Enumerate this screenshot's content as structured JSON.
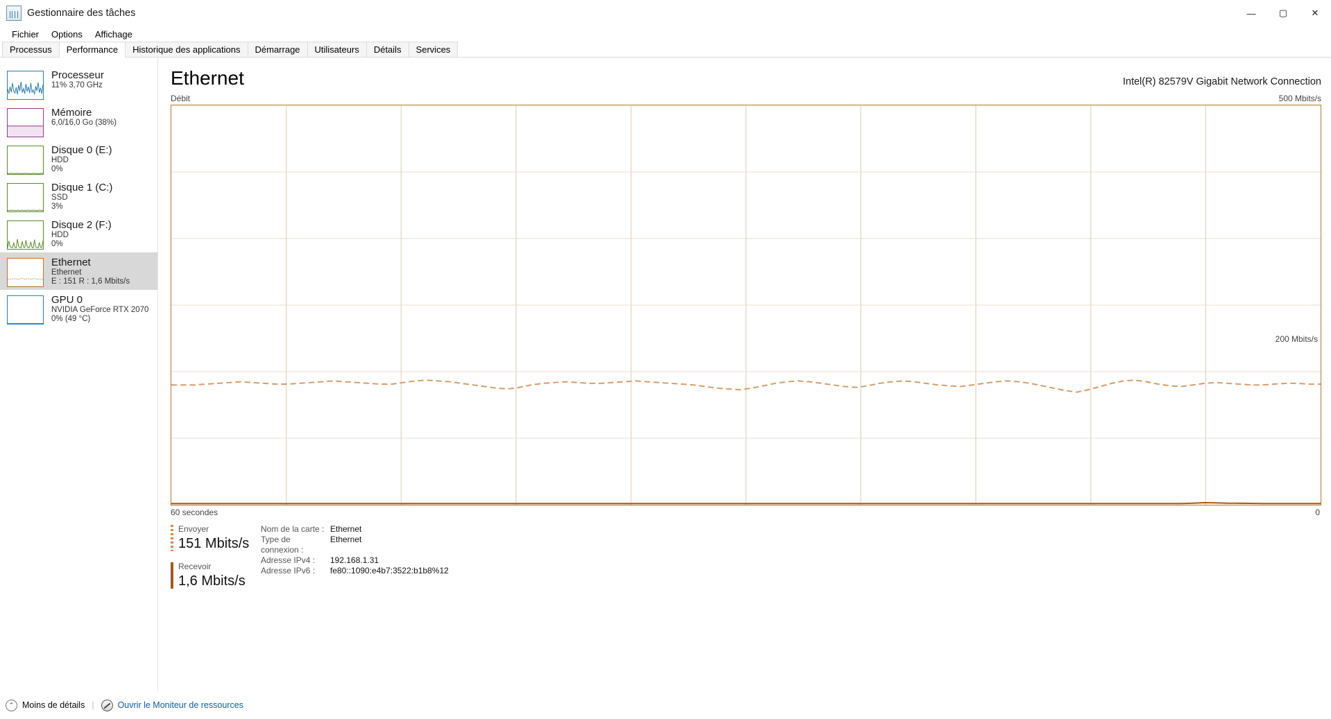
{
  "window": {
    "title": "Gestionnaire des tâches",
    "icon": "task-manager-icon",
    "minimize": "—",
    "maximize": "▢",
    "close": "✕"
  },
  "menu": [
    {
      "label": "Fichier"
    },
    {
      "label": "Options"
    },
    {
      "label": "Affichage"
    }
  ],
  "tabs": [
    {
      "label": "Processus",
      "active": false
    },
    {
      "label": "Performance",
      "active": true
    },
    {
      "label": "Historique des applications",
      "active": false
    },
    {
      "label": "Démarrage",
      "active": false
    },
    {
      "label": "Utilisateurs",
      "active": false
    },
    {
      "label": "Détails",
      "active": false
    },
    {
      "label": "Services",
      "active": false
    }
  ],
  "sidebar": {
    "items": [
      {
        "name": "Processeur",
        "line2": "11% 3,70 GHz",
        "line3": "",
        "color": "#2b7cac",
        "selected": false
      },
      {
        "name": "Mémoire",
        "line2": "6,0/16,0 Go (38%)",
        "line3": "",
        "color": "#8c3c8c",
        "selected": false
      },
      {
        "name": "Disque 0 (E:)",
        "line2": "HDD",
        "line3": "0%",
        "color": "#5a8a2e",
        "selected": false
      },
      {
        "name": "Disque 1 (C:)",
        "line2": "SSD",
        "line3": "3%",
        "color": "#5a8a2e",
        "selected": false
      },
      {
        "name": "Disque 2 (F:)",
        "line2": "HDD",
        "line3": "0%",
        "color": "#5a8a2e",
        "selected": false
      },
      {
        "name": "Ethernet",
        "line2": "Ethernet",
        "line3": "E : 151 R : 1,6 Mbits/s",
        "color": "#b4762b",
        "selected": true
      },
      {
        "name": "GPU 0",
        "line2": "NVIDIA GeForce RTX 2070",
        "line3": "0%  (49 °C)",
        "color": "#2b7cac",
        "selected": false
      }
    ]
  },
  "main": {
    "title": "Ethernet",
    "adapter": "Intel(R) 82579V Gigabit Network Connection",
    "graph_caption": "Débit",
    "axis_max": "500 Mbits/s",
    "axis_mid": "200 Mbits/s",
    "time_span": "60 secondes",
    "time_zero": "0"
  },
  "stats": {
    "send": {
      "label": "Envoyer",
      "value": "151 Mbits/s"
    },
    "receive": {
      "label": "Recevoir",
      "value": "1,6 Mbits/s"
    }
  },
  "details": [
    {
      "key": "Nom de la carte :",
      "value": "Ethernet"
    },
    {
      "key": "Type de connexion :",
      "value": "Ethernet"
    },
    {
      "key": "Adresse IPv4 :",
      "value": "192.168.1.31"
    },
    {
      "key": "Adresse IPv6 :",
      "value": "fe80::1090:e4b7:3522:b1b8%12"
    }
  ],
  "footer": {
    "less_details": "Moins de détails",
    "resource_monitor": "Ouvrir le Moniteur de ressources",
    "chevron": "⌃"
  },
  "colors": {
    "accent": "#b4762b",
    "send_line": "#d99c6b",
    "receive_line": "#a8571c",
    "grid": "#e8ddd0",
    "selected_bg": "#d8d8d8"
  },
  "chart_data": {
    "type": "line",
    "title": "Débit",
    "xlabel": "60 secondes",
    "ylabel": "Mbits/s",
    "ylim": [
      0,
      500
    ],
    "yticks": [
      200,
      500
    ],
    "grid": true,
    "legend": [
      "Envoyer",
      "Recevoir"
    ],
    "series": [
      {
        "name": "Envoyer",
        "style": "dashed",
        "color": "#d99c6b",
        "values": [
          150,
          150,
          150,
          151,
          152,
          153,
          154,
          153,
          152,
          151,
          151,
          152,
          153,
          154,
          155,
          154,
          153,
          152,
          151,
          151,
          153,
          155,
          156,
          155,
          154,
          152,
          150,
          148,
          146,
          145,
          147,
          150,
          152,
          153,
          154,
          153,
          152,
          152,
          153,
          154,
          155,
          154,
          153,
          152,
          151,
          150,
          148,
          146,
          145,
          144,
          146,
          149,
          152,
          154,
          155,
          154,
          152,
          150,
          148,
          147,
          149,
          152,
          154,
          155,
          154,
          152,
          150,
          149,
          148,
          150,
          152,
          154,
          155,
          154,
          152,
          149,
          146,
          143,
          141,
          144,
          148,
          152,
          155,
          156,
          154,
          151,
          149,
          148,
          150,
          152,
          153,
          152,
          151,
          150,
          150,
          151,
          152,
          152,
          151,
          151
        ]
      },
      {
        "name": "Recevoir",
        "style": "solid",
        "color": "#a8571c",
        "values": [
          1.6,
          1.6,
          1.6,
          1.6,
          1.6,
          1.6,
          1.6,
          1.6,
          1.6,
          1.6,
          1.6,
          1.6,
          1.6,
          1.6,
          1.6,
          1.6,
          1.6,
          1.6,
          1.6,
          1.6,
          1.6,
          1.6,
          1.6,
          1.6,
          1.6,
          1.6,
          1.6,
          1.6,
          1.6,
          1.6,
          1.6,
          1.6,
          1.6,
          1.6,
          1.6,
          1.6,
          1.6,
          1.6,
          1.6,
          1.6,
          1.6,
          1.6,
          1.6,
          1.6,
          1.6,
          1.6,
          1.6,
          1.6,
          1.6,
          1.6,
          1.6,
          1.6,
          1.6,
          1.6,
          1.6,
          1.6,
          1.6,
          1.6,
          1.6,
          1.6,
          1.6,
          1.6,
          1.6,
          1.6,
          1.6,
          1.6,
          1.6,
          1.6,
          1.6,
          1.6,
          1.6,
          1.6,
          1.6,
          1.6,
          1.6,
          1.6,
          1.6,
          1.6,
          1.6,
          1.6,
          1.6,
          1.6,
          1.6,
          1.6,
          1.6,
          1.6,
          1.6,
          1.6,
          2.0,
          2.6,
          2.4,
          2.0,
          1.8,
          1.7,
          1.6,
          1.6,
          1.6,
          1.6,
          1.6,
          1.6
        ]
      }
    ]
  },
  "thumbnails": {
    "cpu": [
      38,
      20,
      46,
      26,
      60,
      30,
      22,
      44,
      18,
      52,
      30,
      64,
      24,
      40,
      20,
      56,
      28,
      46,
      22,
      60,
      26,
      34,
      18,
      48,
      30,
      62,
      24,
      42,
      20,
      54
    ],
    "memory_fill": 0.38,
    "disk0": [
      2,
      2,
      2,
      3,
      2,
      2,
      2,
      2,
      3,
      2,
      2,
      2,
      2,
      2,
      3,
      2,
      2,
      2,
      2,
      2,
      2,
      3,
      2,
      2,
      2,
      2,
      2,
      2,
      3,
      2
    ],
    "disk1": [
      3,
      4,
      3,
      5,
      4,
      3,
      4,
      3,
      5,
      4,
      3,
      4,
      5,
      3,
      4,
      3,
      4,
      5,
      3,
      4,
      3,
      5,
      4,
      3,
      4,
      3,
      5,
      4,
      3,
      4
    ],
    "disk2": [
      4,
      30,
      8,
      6,
      4,
      22,
      5,
      4,
      36,
      10,
      5,
      4,
      28,
      7,
      5,
      32,
      9,
      4,
      6,
      26,
      5,
      4,
      34,
      8,
      5,
      4,
      24,
      6,
      5,
      30
    ],
    "ethernet": [
      26,
      27,
      28,
      27,
      26,
      28,
      29,
      28,
      27,
      26,
      27,
      29,
      30,
      28,
      27,
      26,
      28,
      29,
      27,
      26,
      27,
      28,
      29,
      28,
      27,
      26,
      28,
      27,
      26,
      27
    ],
    "gpu": [
      1,
      1,
      1,
      1,
      1,
      1,
      1,
      1,
      1,
      1,
      1,
      1,
      1,
      1,
      1,
      1,
      1,
      1,
      1,
      1,
      1,
      1,
      1,
      1,
      1,
      1,
      1,
      1,
      1,
      1
    ]
  }
}
